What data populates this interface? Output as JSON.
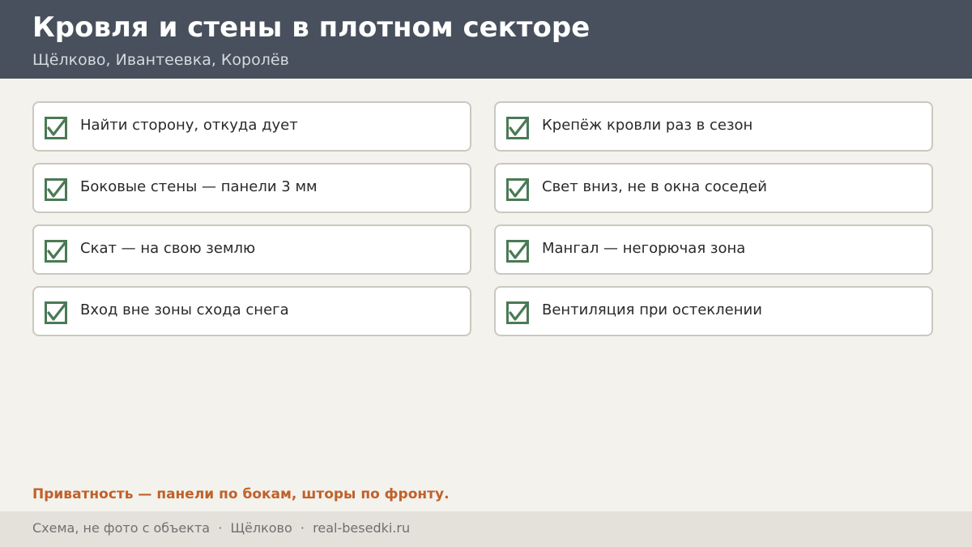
{
  "header": {
    "title": "Кровля и стены в плотном секторе",
    "subtitle": "Щёлково, Ивантеевка, Королёв"
  },
  "colors": {
    "header_bg": "#47505c",
    "check_green": "#4a7a55",
    "accent_orange": "#c0612a"
  },
  "checklist": {
    "icon": "checked-box-icon",
    "left": [
      {
        "label": "Найти сторону, откуда дует",
        "checked": true
      },
      {
        "label": "Боковые стены — панели 3 мм",
        "checked": true
      },
      {
        "label": "Скат — на свою землю",
        "checked": true
      },
      {
        "label": "Вход вне зоны схода снега",
        "checked": true
      }
    ],
    "right": [
      {
        "label": "Крепёж кровли раз в сезон",
        "checked": true
      },
      {
        "label": "Свет вниз, не в окна соседей",
        "checked": true
      },
      {
        "label": "Мангал — негорючая зона",
        "checked": true
      },
      {
        "label": "Вентиляция при остеклении",
        "checked": true
      }
    ]
  },
  "note": "Приватность — панели по бокам, шторы по фронту.",
  "footer": {
    "text": "Схема, не фото с объекта  ·  Щёлково  ·  real-besedki.ru"
  }
}
